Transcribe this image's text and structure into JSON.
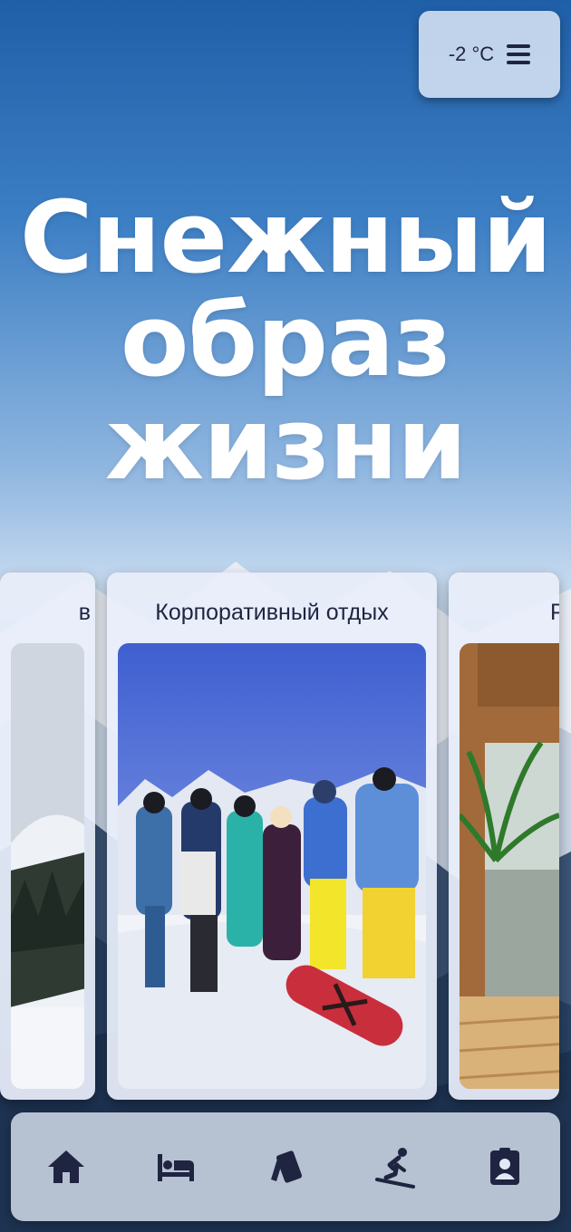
{
  "weather": {
    "temperature": "-2 °C"
  },
  "hero": {
    "line1": "Снежный",
    "line2": "образ",
    "line3": "жизни"
  },
  "carousel": {
    "cards": [
      {
        "title": "в"
      },
      {
        "title": "Корпоративный отдых"
      },
      {
        "title": "Р"
      }
    ]
  },
  "nav": {
    "icons": [
      "home-icon",
      "bed-icon",
      "ski-pass-icon",
      "skier-icon",
      "contacts-icon"
    ]
  },
  "colors": {
    "accent": "#1f2440",
    "sky_top": "#1f5fa8",
    "card_bg": "#e8eefa"
  }
}
